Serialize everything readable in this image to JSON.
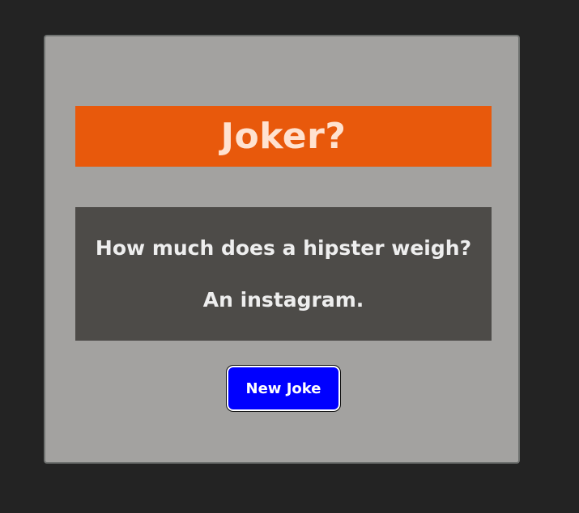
{
  "app": {
    "title": "Joker?"
  },
  "joke": {
    "setup": "How much does a hipster weigh?",
    "punchline": "An instagram."
  },
  "controls": {
    "new_joke_label": "New Joke"
  },
  "colors": {
    "page_background": "#232323",
    "card_background": "#a3a2a0",
    "banner_background": "#e8590c",
    "banner_text": "#ffe2d0",
    "joke_background": "#4d4b48",
    "button_background": "#0000ff"
  }
}
